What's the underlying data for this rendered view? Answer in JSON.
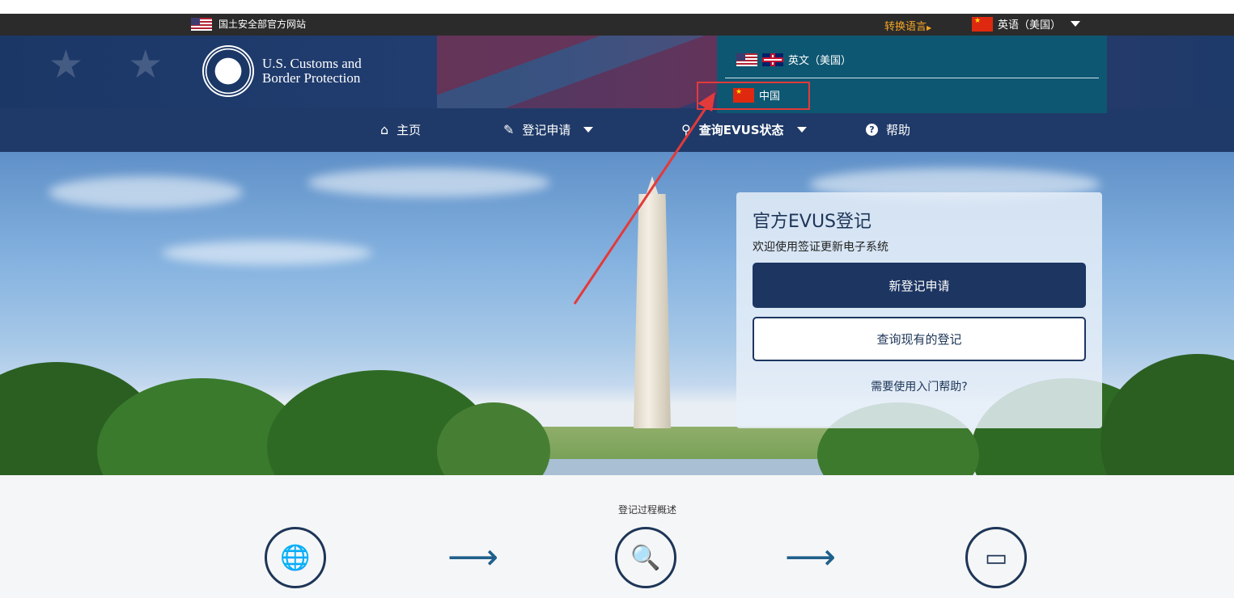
{
  "topbar": {
    "official_site": "国土安全部官方网站",
    "switch_language": "转换语言",
    "current_language": "英语（美国）"
  },
  "header": {
    "agency_line1": "U.S. Customs and",
    "agency_line2": "Border Protection"
  },
  "nav": {
    "home": "主页",
    "register": "登记申请",
    "check_status": "查询EVUS状态",
    "help": "帮助"
  },
  "language_menu": {
    "option_english": "英文（美国）",
    "option_china": "中国"
  },
  "hero_card": {
    "title": "官方EVUS登记",
    "subtitle": "欢迎使用签证更新电子系统",
    "new_registration": "新登记申请",
    "check_existing": "查询现有的登记",
    "help_link": "需要使用入门帮助?"
  },
  "process": {
    "title": "登记过程概述"
  },
  "colors": {
    "navy": "#1d3561",
    "accent_orange": "#f5a623",
    "dropdown_bg": "#0e5772",
    "annotation_red": "#e33a3a"
  },
  "icons": [
    "home-icon",
    "edit-icon",
    "search-icon",
    "help-icon",
    "passport-icon",
    "document-search-icon",
    "credit-card-icon"
  ]
}
